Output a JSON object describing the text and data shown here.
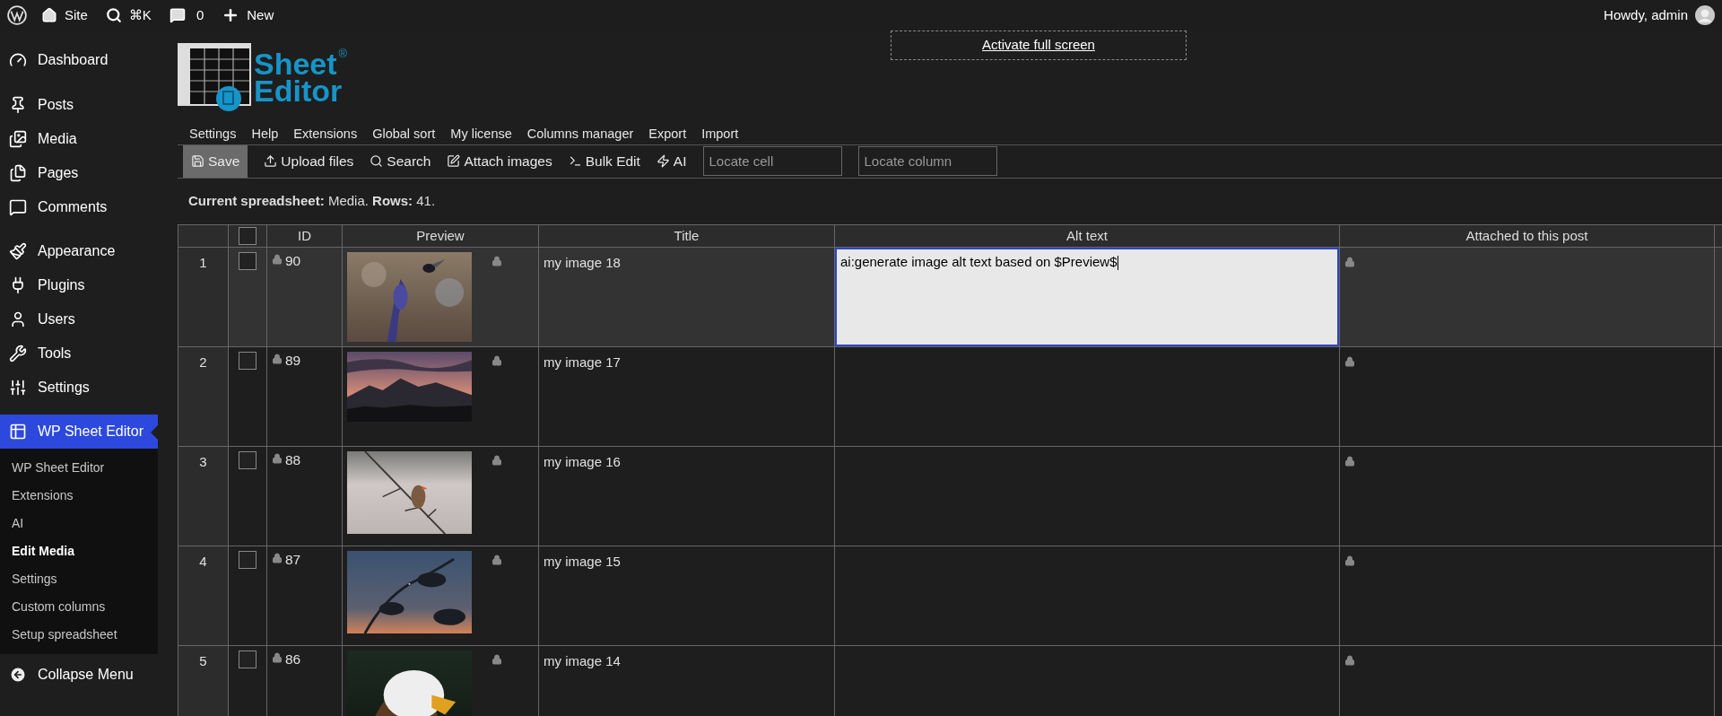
{
  "admin_bar": {
    "site": "Site",
    "search": "⌘K",
    "comments": "0",
    "new": "New",
    "user": "Howdy, admin"
  },
  "sidebar": {
    "items": [
      {
        "label": "Dashboard",
        "selected": false
      },
      {
        "label": "Posts",
        "selected": false
      },
      {
        "label": "Media",
        "selected": false
      },
      {
        "label": "Pages",
        "selected": false
      },
      {
        "label": "Comments",
        "selected": false
      },
      {
        "label": "Appearance",
        "selected": false
      },
      {
        "label": "Plugins",
        "selected": false
      },
      {
        "label": "Users",
        "selected": false
      },
      {
        "label": "Tools",
        "selected": false
      },
      {
        "label": "Settings",
        "selected": false
      },
      {
        "label": "WP Sheet Editor",
        "selected": true,
        "children": [
          {
            "label": "WP Sheet Editor",
            "selected": false
          },
          {
            "label": "Extensions",
            "selected": false
          },
          {
            "label": "AI",
            "selected": false
          },
          {
            "label": "Edit Media",
            "selected": true
          },
          {
            "label": "Settings",
            "selected": false
          },
          {
            "label": "Custom columns",
            "selected": false
          },
          {
            "label": "Setup spreadsheet",
            "selected": false
          }
        ]
      }
    ],
    "collapse": "Collapse Menu"
  },
  "logo": {
    "line1": "Sheet",
    "line2": "Editor",
    "mark": "®"
  },
  "fullscreen_button": "Activate full screen",
  "menu": [
    "Settings",
    "Help",
    "Extensions",
    "Global sort",
    "My license",
    "Columns manager",
    "Export",
    "Import"
  ],
  "toolbar": {
    "buttons": [
      {
        "label": "Save",
        "selected": true
      },
      {
        "label": "Upload files",
        "selected": false
      },
      {
        "label": "Search",
        "selected": false
      },
      {
        "label": "Attach images",
        "selected": false
      },
      {
        "label": "Bulk Edit",
        "selected": false
      },
      {
        "label": "AI",
        "selected": false
      }
    ],
    "fields": [
      {
        "placeholder": "Locate cell"
      },
      {
        "placeholder": "Locate column"
      }
    ]
  },
  "status": "**Current spreadsheet:** Media. **Rows:** 41.",
  "table": {
    "header_checkbox": {
      "checked": false
    },
    "columns": [
      "ID",
      "Preview",
      "Title",
      "Alt text",
      "Attached to this post"
    ],
    "rows": [
      {
        "number": "1",
        "checked": false,
        "selected": true,
        "id": "90",
        "title": "my image 18",
        "alt_text": "ai:generate image alt text based on $Preview$",
        "editing": true
      },
      {
        "number": "2",
        "checked": false,
        "selected": false,
        "id": "89",
        "title": "my image 17",
        "editing": false
      },
      {
        "number": "3",
        "checked": false,
        "selected": false,
        "id": "88",
        "title": "my image 16",
        "editing": false
      },
      {
        "number": "4",
        "checked": false,
        "selected": false,
        "id": "87",
        "title": "my image 15",
        "editing": false
      },
      {
        "number": "5",
        "checked": false,
        "selected": false,
        "id": "86",
        "title": "my image 14",
        "editing": false
      }
    ]
  }
}
